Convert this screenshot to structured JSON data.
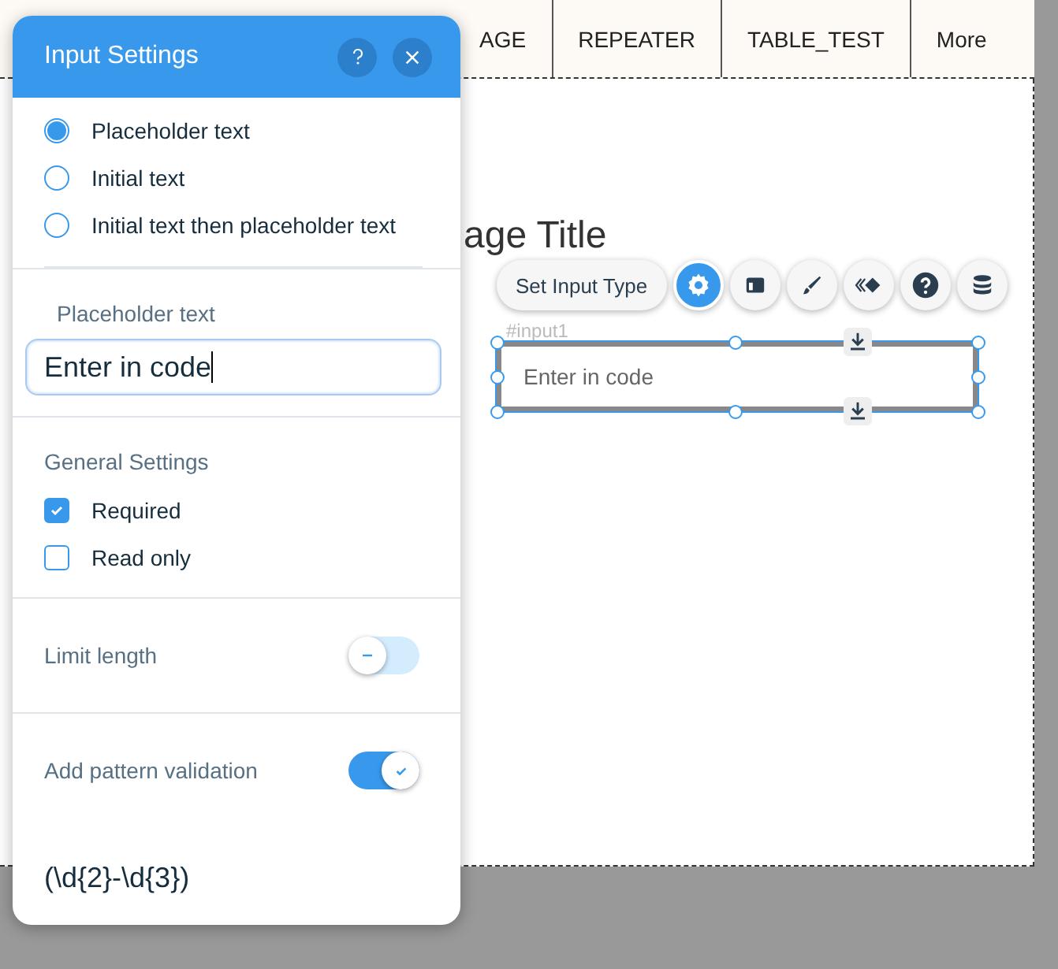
{
  "nav_tabs": [
    {
      "label": "AGE"
    },
    {
      "label": "REPEATER"
    },
    {
      "label": "TABLE_TEST"
    },
    {
      "label": "More"
    }
  ],
  "page_title": "age Title",
  "element_toolbar": {
    "set_type_button": "Set Input Type",
    "icons": [
      {
        "kind": "settings",
        "selected": true
      },
      {
        "kind": "layout",
        "selected": false
      },
      {
        "kind": "design",
        "selected": false
      },
      {
        "kind": "animation",
        "selected": false
      },
      {
        "kind": "help",
        "selected": false
      },
      {
        "kind": "data",
        "selected": false
      }
    ]
  },
  "element": {
    "id_label": "#input1",
    "placeholder": "Enter in code"
  },
  "panel": {
    "title": "Input Settings",
    "text_options": [
      {
        "label": "Placeholder text",
        "selected": true
      },
      {
        "label": "Initial text",
        "selected": false
      },
      {
        "label": "Initial text then placeholder text",
        "selected": false
      }
    ],
    "placeholder_label": "Placeholder text",
    "placeholder_value": "Enter in code",
    "general_heading": "General Settings",
    "checkboxes": [
      {
        "label": "Required",
        "checked": true
      },
      {
        "label": "Read only",
        "checked": false
      }
    ],
    "limit_length": {
      "label": "Limit length",
      "on": false
    },
    "pattern_validation": {
      "label": "Add pattern validation",
      "on": true
    },
    "pattern": "(\\d{2}-\\d{3})"
  }
}
